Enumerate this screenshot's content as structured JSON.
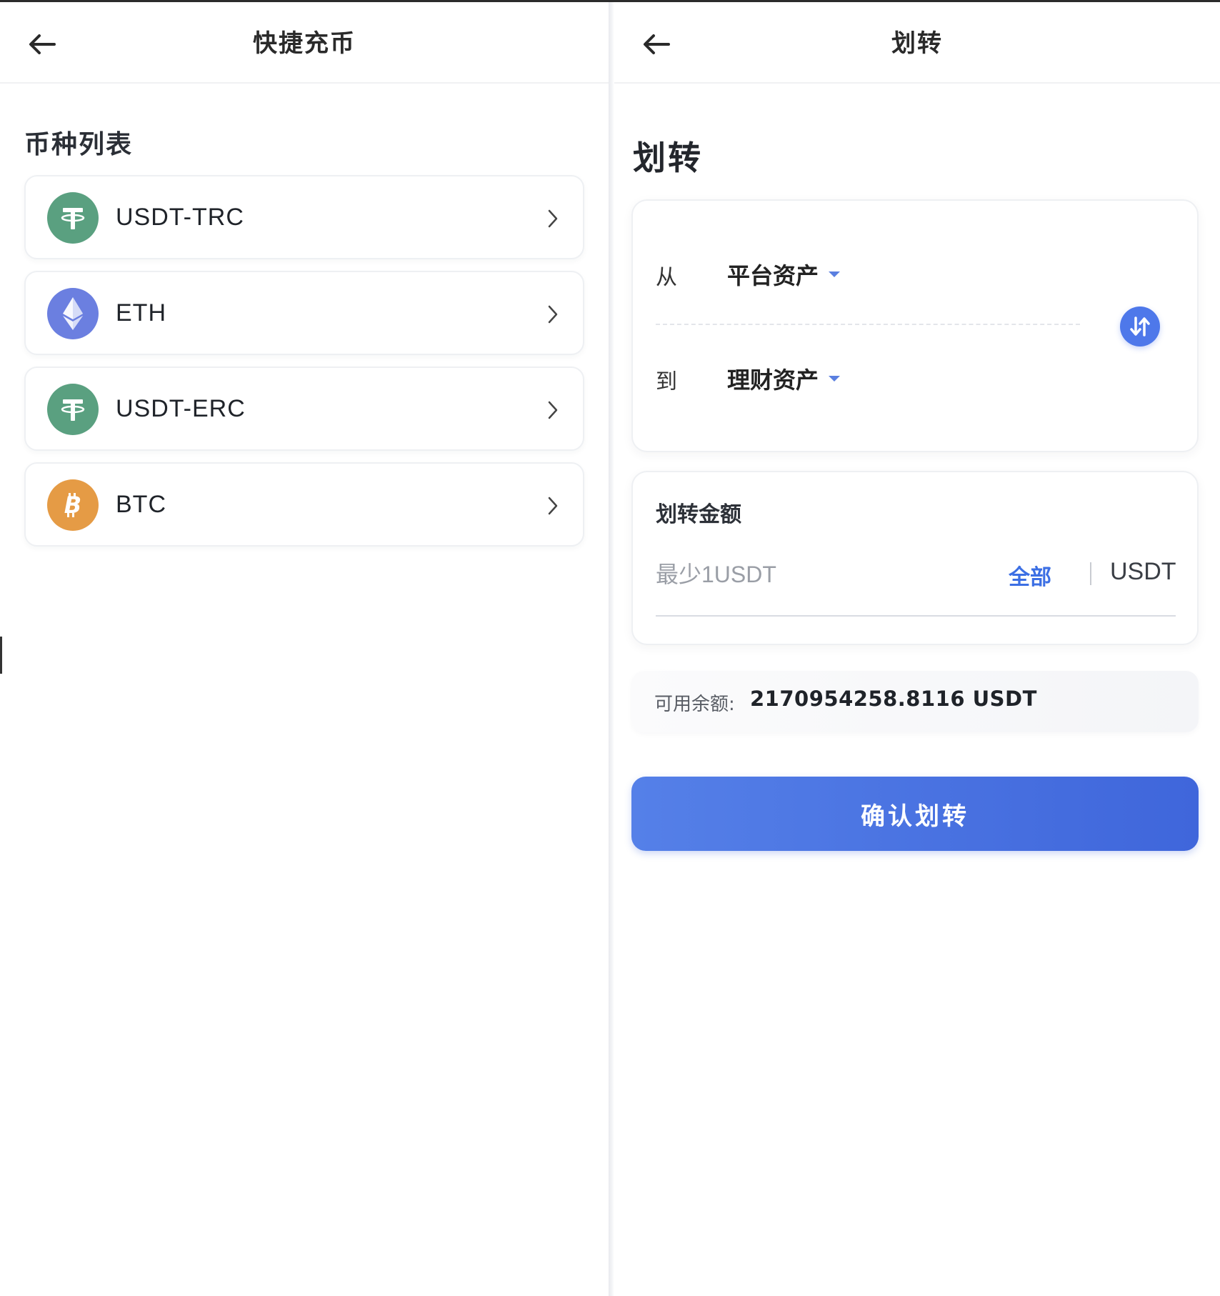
{
  "left_panel": {
    "header": {
      "title": "快捷充币",
      "back_icon": "arrow-left-icon"
    },
    "section_title": "币种列表",
    "coins": [
      {
        "label": "USDT-TRC",
        "icon": "tether-icon",
        "icon_color": "#5aa080"
      },
      {
        "label": "ETH",
        "icon": "ethereum-icon",
        "icon_color": "#6b7fe0"
      },
      {
        "label": "USDT-ERC",
        "icon": "tether-icon",
        "icon_color": "#5aa080"
      },
      {
        "label": "BTC",
        "icon": "bitcoin-icon",
        "icon_color": "#e59b45"
      }
    ]
  },
  "right_panel": {
    "header": {
      "title": "划转",
      "back_icon": "arrow-left-icon"
    },
    "page_title": "划转",
    "transfer": {
      "from_label": "从",
      "from_value": "平台资产",
      "to_label": "到",
      "to_value": "理财资产",
      "swap_icon": "swap-arrows-icon"
    },
    "amount": {
      "label": "划转金额",
      "placeholder": "最少1USDT",
      "all_label": "全部",
      "unit": "USDT"
    },
    "balance": {
      "label": "可用余额:",
      "value": "2170954258.8116 USDT"
    },
    "confirm_label": "确认划转"
  },
  "colors": {
    "accent": "#4e78ea",
    "tether": "#5aa080",
    "ethereum": "#6b7fe0",
    "bitcoin": "#e59b45"
  }
}
